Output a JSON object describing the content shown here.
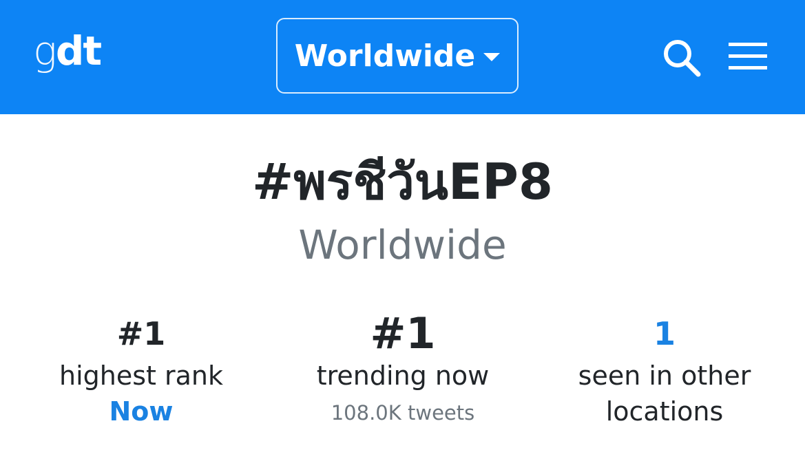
{
  "navbar": {
    "logo_light": "g",
    "logo_bold": "dt",
    "location_label": "Worldwide",
    "search_icon": "search-icon",
    "menu_icon": "hamburger-menu-icon",
    "bg_color": "#0d84f5"
  },
  "trend": {
    "title": "#พรชีวันEP8",
    "location": "Worldwide"
  },
  "stats": {
    "highest_rank": {
      "value": "#1",
      "label": "highest rank",
      "when": "Now"
    },
    "trending_now": {
      "value": "#1",
      "label": "trending now",
      "tweets": "108.0K tweets"
    },
    "other_locations": {
      "value": "1",
      "label_line1": "seen in other",
      "label_line2": "locations"
    }
  },
  "colors": {
    "accent": "#1a82e2",
    "text_dark": "#212529",
    "text_muted": "#6c757d"
  }
}
